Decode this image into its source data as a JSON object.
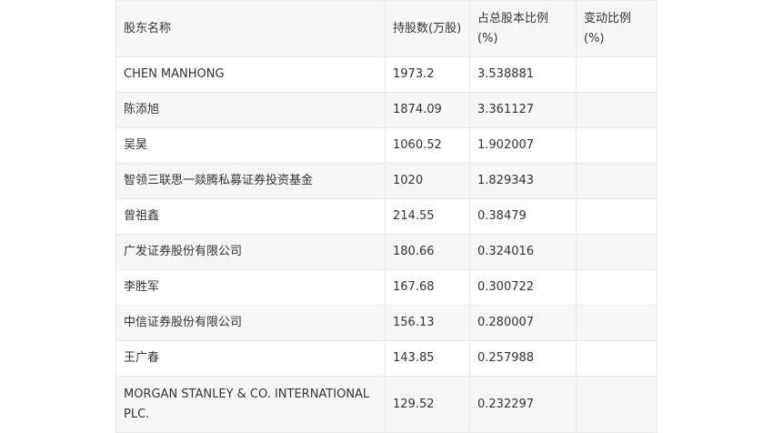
{
  "table": {
    "headers": [
      "股东名称",
      "持股数(万股)",
      "占总股本比例(%)",
      "变动比例(%)"
    ],
    "rows": [
      {
        "name": "CHEN MANHONG",
        "shares": "1973.2",
        "ratio": "3.538881",
        "change": ""
      },
      {
        "name": "陈添旭",
        "shares": "1874.09",
        "ratio": "3.361127",
        "change": ""
      },
      {
        "name": "吴昊",
        "shares": "1060.52",
        "ratio": "1.902007",
        "change": ""
      },
      {
        "name": "智领三联思一燚腾私募证券投资基金",
        "shares": "1020",
        "ratio": "1.829343",
        "change": ""
      },
      {
        "name": "曾祖鑫",
        "shares": "214.55",
        "ratio": "0.38479",
        "change": ""
      },
      {
        "name": "广发证券股份有限公司",
        "shares": "180.66",
        "ratio": "0.324016",
        "change": ""
      },
      {
        "name": "李胜军",
        "shares": "167.68",
        "ratio": "0.300722",
        "change": ""
      },
      {
        "name": "中信证券股份有限公司",
        "shares": "156.13",
        "ratio": "0.280007",
        "change": ""
      },
      {
        "name": "王广春",
        "shares": "143.85",
        "ratio": "0.257988",
        "change": ""
      },
      {
        "name": "MORGAN STANLEY & CO. INTERNATIONAL PLC.",
        "shares": "129.52",
        "ratio": "0.232297",
        "change": ""
      }
    ]
  }
}
